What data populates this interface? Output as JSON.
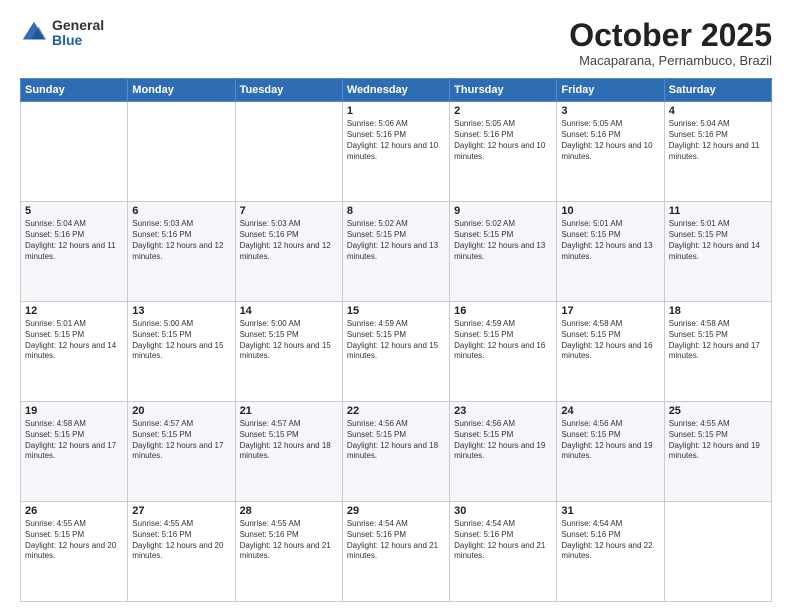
{
  "logo": {
    "general": "General",
    "blue": "Blue"
  },
  "header": {
    "month": "October 2025",
    "location": "Macaparana, Pernambuco, Brazil"
  },
  "days_of_week": [
    "Sunday",
    "Monday",
    "Tuesday",
    "Wednesday",
    "Thursday",
    "Friday",
    "Saturday"
  ],
  "weeks": [
    [
      {
        "day": "",
        "sunrise": "",
        "sunset": "",
        "daylight": ""
      },
      {
        "day": "",
        "sunrise": "",
        "sunset": "",
        "daylight": ""
      },
      {
        "day": "",
        "sunrise": "",
        "sunset": "",
        "daylight": ""
      },
      {
        "day": "1",
        "sunrise": "Sunrise: 5:06 AM",
        "sunset": "Sunset: 5:16 PM",
        "daylight": "Daylight: 12 hours and 10 minutes."
      },
      {
        "day": "2",
        "sunrise": "Sunrise: 5:05 AM",
        "sunset": "Sunset: 5:16 PM",
        "daylight": "Daylight: 12 hours and 10 minutes."
      },
      {
        "day": "3",
        "sunrise": "Sunrise: 5:05 AM",
        "sunset": "Sunset: 5:16 PM",
        "daylight": "Daylight: 12 hours and 10 minutes."
      },
      {
        "day": "4",
        "sunrise": "Sunrise: 5:04 AM",
        "sunset": "Sunset: 5:16 PM",
        "daylight": "Daylight: 12 hours and 11 minutes."
      }
    ],
    [
      {
        "day": "5",
        "sunrise": "Sunrise: 5:04 AM",
        "sunset": "Sunset: 5:16 PM",
        "daylight": "Daylight: 12 hours and 11 minutes."
      },
      {
        "day": "6",
        "sunrise": "Sunrise: 5:03 AM",
        "sunset": "Sunset: 5:16 PM",
        "daylight": "Daylight: 12 hours and 12 minutes."
      },
      {
        "day": "7",
        "sunrise": "Sunrise: 5:03 AM",
        "sunset": "Sunset: 5:16 PM",
        "daylight": "Daylight: 12 hours and 12 minutes."
      },
      {
        "day": "8",
        "sunrise": "Sunrise: 5:02 AM",
        "sunset": "Sunset: 5:15 PM",
        "daylight": "Daylight: 12 hours and 13 minutes."
      },
      {
        "day": "9",
        "sunrise": "Sunrise: 5:02 AM",
        "sunset": "Sunset: 5:15 PM",
        "daylight": "Daylight: 12 hours and 13 minutes."
      },
      {
        "day": "10",
        "sunrise": "Sunrise: 5:01 AM",
        "sunset": "Sunset: 5:15 PM",
        "daylight": "Daylight: 12 hours and 13 minutes."
      },
      {
        "day": "11",
        "sunrise": "Sunrise: 5:01 AM",
        "sunset": "Sunset: 5:15 PM",
        "daylight": "Daylight: 12 hours and 14 minutes."
      }
    ],
    [
      {
        "day": "12",
        "sunrise": "Sunrise: 5:01 AM",
        "sunset": "Sunset: 5:15 PM",
        "daylight": "Daylight: 12 hours and 14 minutes."
      },
      {
        "day": "13",
        "sunrise": "Sunrise: 5:00 AM",
        "sunset": "Sunset: 5:15 PM",
        "daylight": "Daylight: 12 hours and 15 minutes."
      },
      {
        "day": "14",
        "sunrise": "Sunrise: 5:00 AM",
        "sunset": "Sunset: 5:15 PM",
        "daylight": "Daylight: 12 hours and 15 minutes."
      },
      {
        "day": "15",
        "sunrise": "Sunrise: 4:59 AM",
        "sunset": "Sunset: 5:15 PM",
        "daylight": "Daylight: 12 hours and 15 minutes."
      },
      {
        "day": "16",
        "sunrise": "Sunrise: 4:59 AM",
        "sunset": "Sunset: 5:15 PM",
        "daylight": "Daylight: 12 hours and 16 minutes."
      },
      {
        "day": "17",
        "sunrise": "Sunrise: 4:58 AM",
        "sunset": "Sunset: 5:15 PM",
        "daylight": "Daylight: 12 hours and 16 minutes."
      },
      {
        "day": "18",
        "sunrise": "Sunrise: 4:58 AM",
        "sunset": "Sunset: 5:15 PM",
        "daylight": "Daylight: 12 hours and 17 minutes."
      }
    ],
    [
      {
        "day": "19",
        "sunrise": "Sunrise: 4:58 AM",
        "sunset": "Sunset: 5:15 PM",
        "daylight": "Daylight: 12 hours and 17 minutes."
      },
      {
        "day": "20",
        "sunrise": "Sunrise: 4:57 AM",
        "sunset": "Sunset: 5:15 PM",
        "daylight": "Daylight: 12 hours and 17 minutes."
      },
      {
        "day": "21",
        "sunrise": "Sunrise: 4:57 AM",
        "sunset": "Sunset: 5:15 PM",
        "daylight": "Daylight: 12 hours and 18 minutes."
      },
      {
        "day": "22",
        "sunrise": "Sunrise: 4:56 AM",
        "sunset": "Sunset: 5:15 PM",
        "daylight": "Daylight: 12 hours and 18 minutes."
      },
      {
        "day": "23",
        "sunrise": "Sunrise: 4:56 AM",
        "sunset": "Sunset: 5:15 PM",
        "daylight": "Daylight: 12 hours and 19 minutes."
      },
      {
        "day": "24",
        "sunrise": "Sunrise: 4:56 AM",
        "sunset": "Sunset: 5:15 PM",
        "daylight": "Daylight: 12 hours and 19 minutes."
      },
      {
        "day": "25",
        "sunrise": "Sunrise: 4:55 AM",
        "sunset": "Sunset: 5:15 PM",
        "daylight": "Daylight: 12 hours and 19 minutes."
      }
    ],
    [
      {
        "day": "26",
        "sunrise": "Sunrise: 4:55 AM",
        "sunset": "Sunset: 5:15 PM",
        "daylight": "Daylight: 12 hours and 20 minutes."
      },
      {
        "day": "27",
        "sunrise": "Sunrise: 4:55 AM",
        "sunset": "Sunset: 5:16 PM",
        "daylight": "Daylight: 12 hours and 20 minutes."
      },
      {
        "day": "28",
        "sunrise": "Sunrise: 4:55 AM",
        "sunset": "Sunset: 5:16 PM",
        "daylight": "Daylight: 12 hours and 21 minutes."
      },
      {
        "day": "29",
        "sunrise": "Sunrise: 4:54 AM",
        "sunset": "Sunset: 5:16 PM",
        "daylight": "Daylight: 12 hours and 21 minutes."
      },
      {
        "day": "30",
        "sunrise": "Sunrise: 4:54 AM",
        "sunset": "Sunset: 5:16 PM",
        "daylight": "Daylight: 12 hours and 21 minutes."
      },
      {
        "day": "31",
        "sunrise": "Sunrise: 4:54 AM",
        "sunset": "Sunset: 5:16 PM",
        "daylight": "Daylight: 12 hours and 22 minutes."
      },
      {
        "day": "",
        "sunrise": "",
        "sunset": "",
        "daylight": ""
      }
    ]
  ]
}
